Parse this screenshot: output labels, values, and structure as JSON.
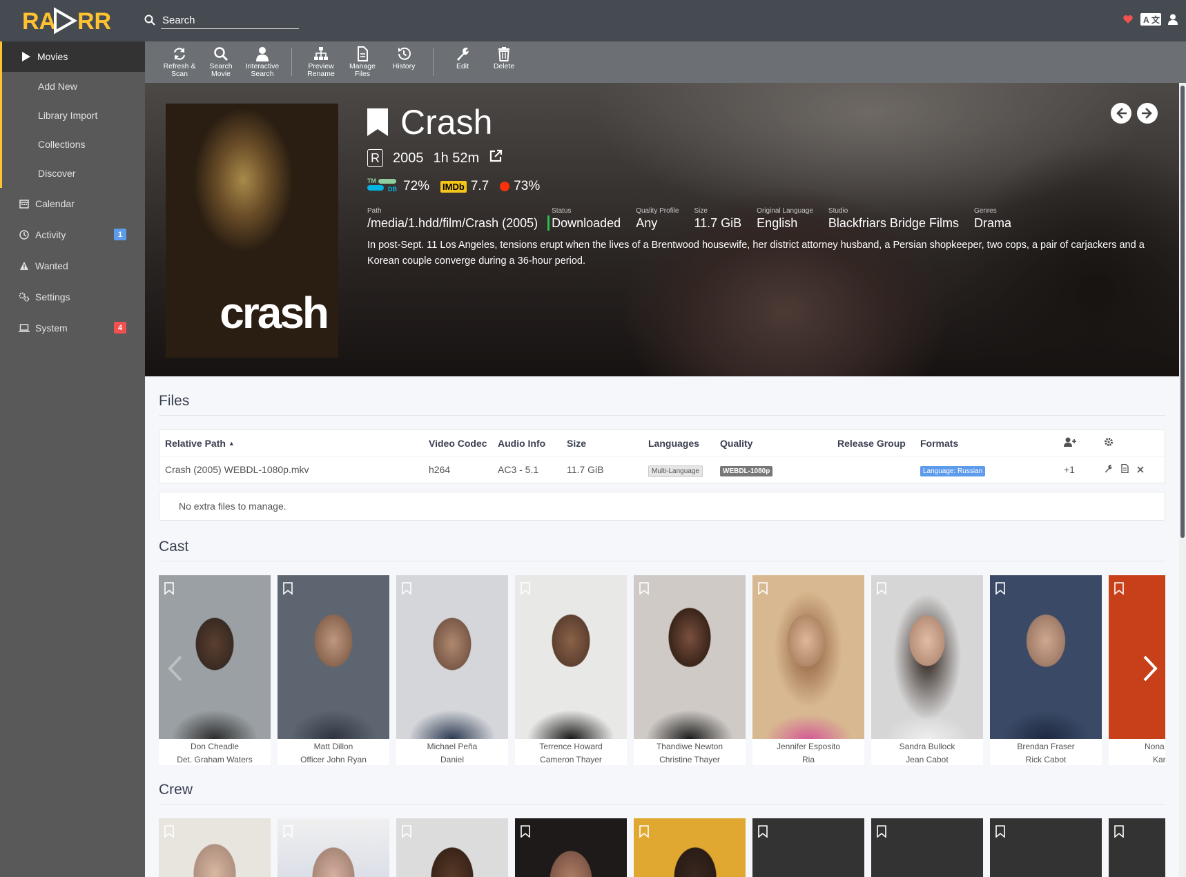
{
  "app": {
    "name": "Radarr",
    "search_placeholder": "Search"
  },
  "sidebar": {
    "movies": "Movies",
    "movie_subitems": [
      "Add New",
      "Library Import",
      "Collections",
      "Discover"
    ],
    "calendar": "Calendar",
    "activity": "Activity",
    "activity_badge": "1",
    "wanted": "Wanted",
    "settings": "Settings",
    "system": "System",
    "system_badge": "4"
  },
  "toolbar": {
    "refresh": "Refresh & Scan",
    "search_movie": "Search Movie",
    "interactive_search": "Interactive Search",
    "preview_rename": "Preview Rename",
    "manage_files": "Manage Files",
    "history": "History",
    "edit": "Edit",
    "delete": "Delete"
  },
  "movie": {
    "title": "Crash",
    "poster_title": "crash",
    "certification": "R",
    "year": "2005",
    "runtime": "1h 52m",
    "tmdb_rating": "72%",
    "imdb_label": "IMDb",
    "imdb_rating": "7.7",
    "rt_rating": "73%",
    "path_label": "Path",
    "path": "/media/1.hdd/film/Crash (2005)",
    "status_label": "Status",
    "status": "Downloaded",
    "quality_profile_label": "Quality Profile",
    "quality_profile": "Any",
    "size_label": "Size",
    "size": "11.7 GiB",
    "language_label": "Original Language",
    "language": "English",
    "studio_label": "Studio",
    "studio": "Blackfriars Bridge Films",
    "genres_label": "Genres",
    "genres": "Drama",
    "overview": "In post-Sept. 11 Los Angeles, tensions erupt when the lives of a Brentwood housewife, her district attorney husband, a Persian shopkeeper, two cops, a pair of carjackers and a Korean couple converge during a 36-hour period."
  },
  "files": {
    "title": "Files",
    "columns": [
      "Relative Path",
      "Video Codec",
      "Audio Info",
      "Size",
      "Languages",
      "Quality",
      "Release Group",
      "Formats"
    ],
    "row": {
      "path": "Crash (2005) WEBDL-1080p.mkv",
      "codec": "h264",
      "audio": "AC3 - 5.1",
      "size": "11.7 GiB",
      "languages": "Multi-Language",
      "quality": "WEBDL-1080p",
      "release_group": "",
      "formats": "Language: Russian",
      "score": "+1"
    },
    "extra_files": "No extra files to manage."
  },
  "cast": {
    "title": "Cast",
    "people": [
      {
        "name": "Don Cheadle",
        "role": "Det. Graham Waters"
      },
      {
        "name": "Matt Dillon",
        "role": "Officer John Ryan"
      },
      {
        "name": "Michael Peña",
        "role": "Daniel"
      },
      {
        "name": "Terrence Howard",
        "role": "Cameron Thayer"
      },
      {
        "name": "Thandiwe Newton",
        "role": "Christine Thayer"
      },
      {
        "name": "Jennifer Esposito",
        "role": "Ria"
      },
      {
        "name": "Sandra Bullock",
        "role": "Jean Cabot"
      },
      {
        "name": "Brendan Fraser",
        "role": "Rick Cabot"
      },
      {
        "name": "Nona",
        "role": "Kar"
      }
    ]
  },
  "crew": {
    "title": "Crew"
  },
  "colors": {
    "accent": "#ffc230",
    "header": "#464b51",
    "sidebar": "#595959",
    "toolbar": "#6c7075",
    "badge_blue": "#5d9cec",
    "badge_red": "#f05050",
    "status_green": "#27c24c"
  }
}
